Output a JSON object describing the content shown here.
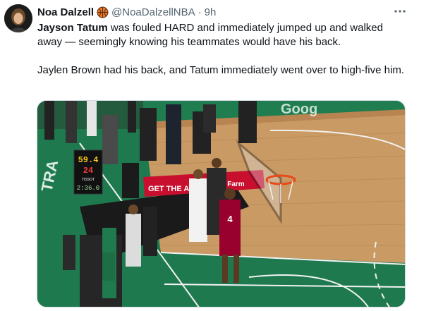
{
  "author": {
    "display_name": "Noa Dalzell",
    "badge_icon": "basketball-icon",
    "handle": "@NoaDalzellNBA",
    "separator": "·",
    "timestamp": "9h"
  },
  "more_icon": "more-options-icon",
  "tweet": {
    "line1_bold": "Jayson Tatum",
    "line1_rest": " was fouled HARD and immediately jumped up and walked away — seemingly knowing his teammates would have his back.",
    "line2": "Jaylen Brown had his back, and Tatum immediately went over to high-five him."
  },
  "media": {
    "banner_get_the_app": "GET THE App",
    "banner_sponsor": "State Farm",
    "shot_clock_top": "59.4",
    "shot_clock_bottom": "24",
    "clock_brand": "TISSOT",
    "clock_bottom": "2:36.0",
    "court_text_left": "TRA",
    "court_text_top": "Goog",
    "player_number": "4",
    "colors": {
      "court_green": "#1e7a4e",
      "wood": "#c99a64",
      "banner_red": "#c8102e",
      "jersey_red": "#98002e"
    }
  }
}
